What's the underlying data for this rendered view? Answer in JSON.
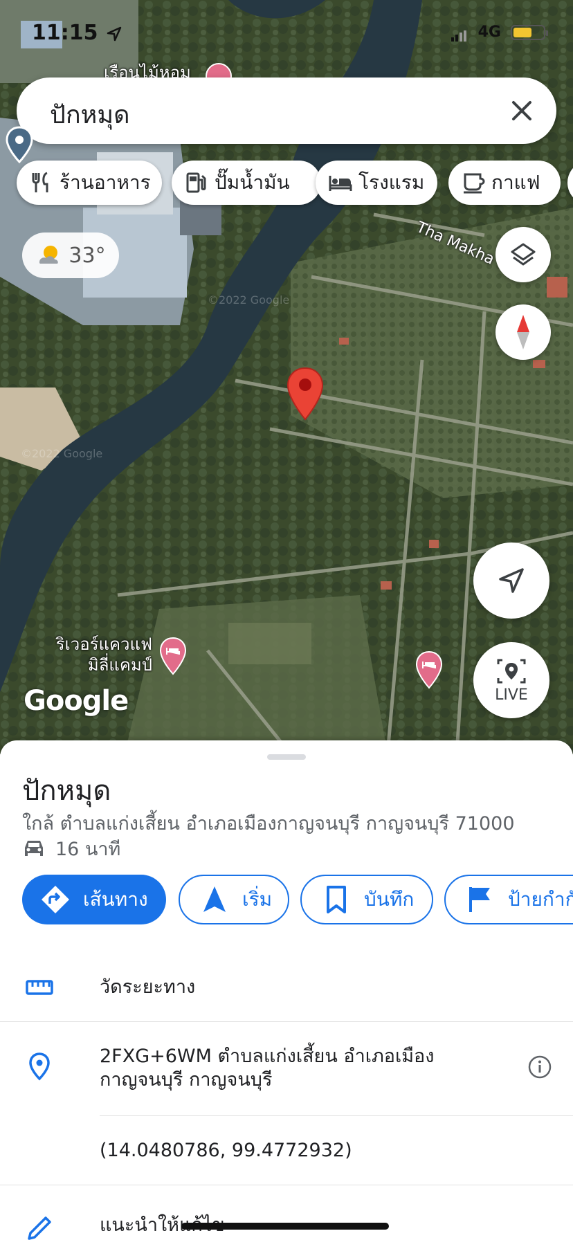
{
  "status_bar": {
    "time": "11:15",
    "network": "4G",
    "battery_level": 0.55
  },
  "search": {
    "query": "ปักหมุด"
  },
  "chips": [
    {
      "icon": "restaurant-icon",
      "label": "ร้านอาหาร"
    },
    {
      "icon": "gas-station-icon",
      "label": "ปั๊มน้ำมัน"
    },
    {
      "icon": "hotel-icon",
      "label": "โรงแรม"
    },
    {
      "icon": "coffee-icon",
      "label": "กาแฟ"
    }
  ],
  "weather": {
    "temperature": "33°"
  },
  "map": {
    "road_label": "Tha Makha",
    "poi_top": "เรือนไม้หอม",
    "poi_river_cafe_line1": "ริเวอร์แควแฟ",
    "poi_river_cafe_line2": "มิลี่แคมป์",
    "live_label": "LIVE",
    "logo": "Google",
    "watermark": "©2022 Google",
    "pin_color": "#ea4335"
  },
  "place": {
    "title": "ปักหมุด",
    "address": "ใกล้ ตำบลแก่งเสี้ยน อำเภอเมืองกาญจนบุรี กาญจนบุรี 71000",
    "drive_time": "16 นาที"
  },
  "actions": [
    {
      "icon": "directions-icon",
      "label": "เส้นทาง",
      "style": "primary"
    },
    {
      "icon": "navigation-start-icon",
      "label": "เริ่ม",
      "style": "outline"
    },
    {
      "icon": "bookmark-icon",
      "label": "บันทึก",
      "style": "outline"
    },
    {
      "icon": "flag-icon",
      "label": "ป้ายกำกับ",
      "style": "outline"
    }
  ],
  "details": {
    "measure": "วัดระยะทาง",
    "plus_code_line1": "2FXG+6WM ตำบลแก่งเสี้ยน อำเภอเมือง",
    "plus_code_line2": "กาญจนบุรี กาญจนบุรี",
    "coordinates": "(14.0480786, 99.4772932)",
    "suggest_edit": "แนะนำให้แก้ไข"
  },
  "colors": {
    "accent": "#1a73e8",
    "poi_pink": "#e26c8a"
  }
}
